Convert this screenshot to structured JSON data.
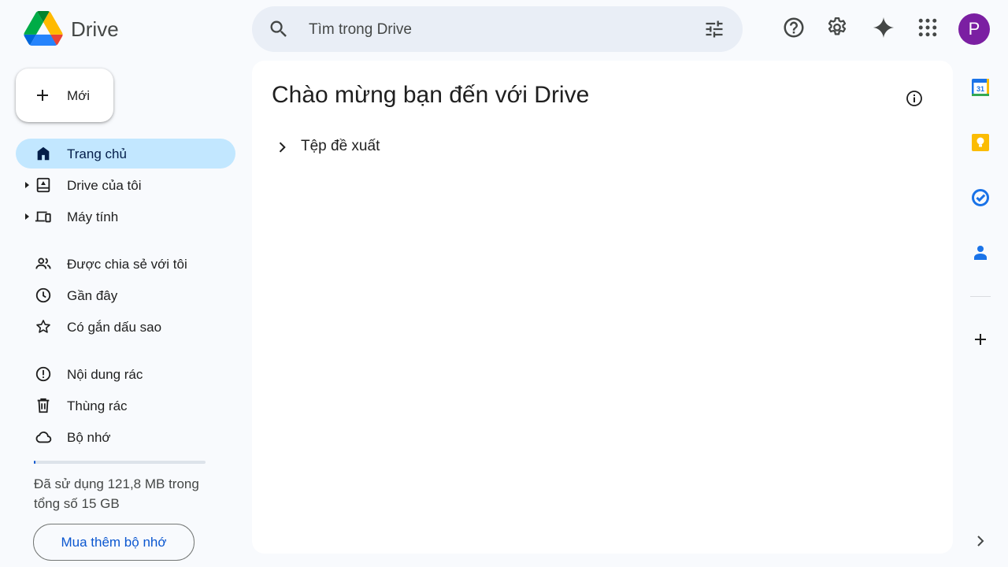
{
  "header": {
    "app_name": "Drive",
    "search_placeholder": "Tìm trong Drive",
    "icons": [
      "search-icon",
      "filter-icon",
      "help-icon",
      "settings-icon",
      "gemini-icon",
      "apps-grid-icon"
    ],
    "avatar_letter": "P"
  },
  "sidebar": {
    "new_label": "Mới",
    "items": [
      {
        "label": "Trang chủ",
        "icon": "home-icon",
        "active": true
      },
      {
        "label": "Drive của tôi",
        "icon": "my-drive-icon",
        "expandable": true
      },
      {
        "label": "Máy tính",
        "icon": "computers-icon",
        "expandable": true
      },
      {
        "label": "Được chia sẻ với tôi",
        "icon": "shared-icon"
      },
      {
        "label": "Gần đây",
        "icon": "clock-icon"
      },
      {
        "label": "Có gắn dấu sao",
        "icon": "star-icon"
      },
      {
        "label": "Nội dung rác",
        "icon": "spam-icon"
      },
      {
        "label": "Thùng rác",
        "icon": "trash-icon"
      },
      {
        "label": "Bộ nhớ",
        "icon": "cloud-icon"
      }
    ],
    "storage": {
      "text": "Đã sử dụng 121,8 MB trong tổng số 15 GB",
      "used_fraction": 0.008
    },
    "buy_label": "Mua thêm bộ nhớ"
  },
  "main": {
    "title": "Chào mừng bạn đến với Drive",
    "suggested_label": "Tệp đề xuất"
  },
  "right_rail": {
    "icons": [
      "calendar-icon",
      "keep-icon",
      "tasks-icon",
      "contacts-icon",
      "add-icon",
      "expand-icon"
    ],
    "calendar_day": "31"
  },
  "colors": {
    "accent": "#0b57d0",
    "active_bg": "#c2e7ff",
    "avatar_bg": "#7b1fa2",
    "background": "#f8fafd"
  }
}
